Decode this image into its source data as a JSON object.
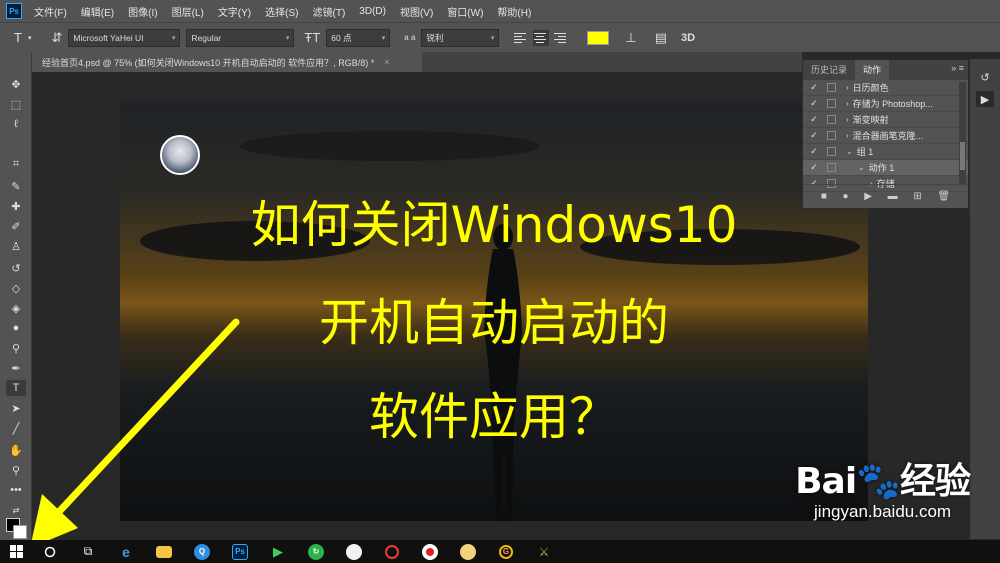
{
  "app": {
    "logo": "Ps"
  },
  "menu": [
    "文件(F)",
    "编辑(E)",
    "图像(I)",
    "图层(L)",
    "文字(Y)",
    "选择(S)",
    "滤镜(T)",
    "3D(D)",
    "视图(V)",
    "窗口(W)",
    "帮助(H)"
  ],
  "options": {
    "font_family": "Microsoft YaHei UI",
    "font_style": "Regular",
    "font_size": "60 点",
    "aa_label": "a a",
    "antialias": "锐利",
    "text_color": "#ffff00",
    "btn_3d": "3D"
  },
  "document_tab": {
    "title": "经验首页4.psd @ 75% (如何关闭Windows10 开机自动启动的 软件应用？, RGB/8) *",
    "close": "×"
  },
  "canvas_text": {
    "line1": "如何关闭Windows10",
    "line2": "开机自动启动的",
    "line3": "软件应用？"
  },
  "panel": {
    "tabs": [
      "历史记录",
      "动作"
    ],
    "menu": "»  ≡",
    "rows": [
      {
        "check": "✓",
        "label": "日历颜色",
        "indent": 0,
        "tri": "›",
        "selected": false
      },
      {
        "check": "✓",
        "label": "存储为 Photoshop...",
        "indent": 0,
        "tri": "›",
        "selected": false
      },
      {
        "check": "✓",
        "label": "渐变映射",
        "indent": 0,
        "tri": "›",
        "selected": false
      },
      {
        "check": "✓",
        "label": "混合器画笔克隆...",
        "indent": 0,
        "tri": "›",
        "selected": false
      },
      {
        "check": "✓",
        "label": "组 1",
        "indent": 0,
        "tri": "⌄",
        "selected": false
      },
      {
        "check": "✓",
        "label": "动作 1",
        "indent": 1,
        "tri": "⌄",
        "selected": true
      },
      {
        "check": "✓",
        "label": "存储",
        "indent": 2,
        "tri": "›",
        "selected": false
      }
    ],
    "footer": [
      "■",
      "●",
      "▶",
      "▬",
      "⊞",
      "🗑"
    ]
  },
  "watermark": {
    "logo": "Bai🐾经验",
    "url": "jingyan.baidu.com"
  },
  "colors": {
    "annotation_arrow": "#ffff00",
    "canvas_text": "#ffff00"
  }
}
